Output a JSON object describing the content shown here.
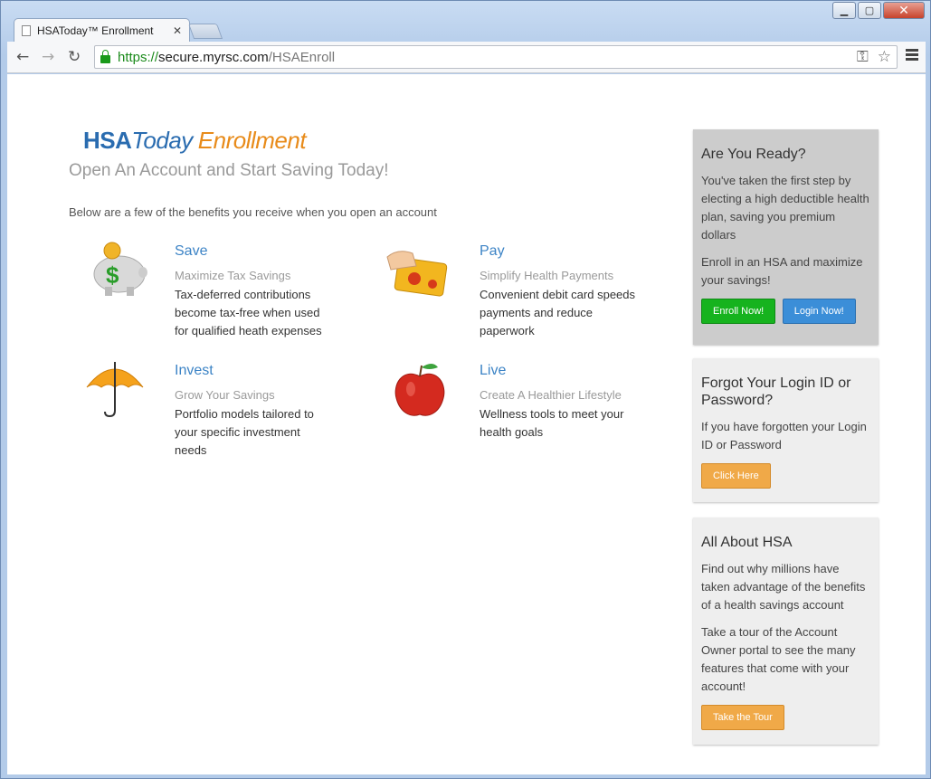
{
  "browser": {
    "tab_title": "HSAToday™ Enrollment",
    "tab_close": "✕",
    "url_scheme": "https://",
    "url_host": "secure.myrsc.com",
    "url_path": "/HSAEnroll"
  },
  "header": {
    "logo_hsa": "HSA",
    "logo_today": "Today",
    "logo_enroll": "Enrollment",
    "headline": "Open An Account and Start Saving Today!",
    "intro": "Below are a few of the benefits you receive when you open an account"
  },
  "benefits": {
    "save": {
      "title": "Save",
      "subtitle": "Maximize Tax Savings",
      "description": "Tax-deferred contributions become tax-free when used for qualified heath expenses"
    },
    "pay": {
      "title": "Pay",
      "subtitle": "Simplify Health Payments",
      "description": "Convenient debit card speeds payments and reduce paperwork"
    },
    "invest": {
      "title": "Invest",
      "subtitle": "Grow Your Savings",
      "description": "Portfolio models tailored to your specific investment needs"
    },
    "live": {
      "title": "Live",
      "subtitle": "Create A Healthier Lifestyle",
      "description": "Wellness tools to meet your health goals"
    }
  },
  "sidebar": {
    "ready": {
      "title": "Are You Ready?",
      "text1": "You've taken the first step by electing a high deductible health plan, saving you premium dollars",
      "text2": "Enroll in an HSA and maximize your savings!",
      "enroll_btn": "Enroll Now!",
      "login_btn": "Login Now!"
    },
    "forgot": {
      "title": "Forgot Your Login ID or Password?",
      "text": "If you have forgotten your Login ID or Password",
      "btn": "Click Here"
    },
    "about": {
      "title": "All About HSA",
      "text1": "Find out why millions have taken advantage of the benefits of a health savings account",
      "text2": "Take a tour of the Account Owner portal to see the many features that come with your account!",
      "btn": "Take the Tour"
    }
  }
}
